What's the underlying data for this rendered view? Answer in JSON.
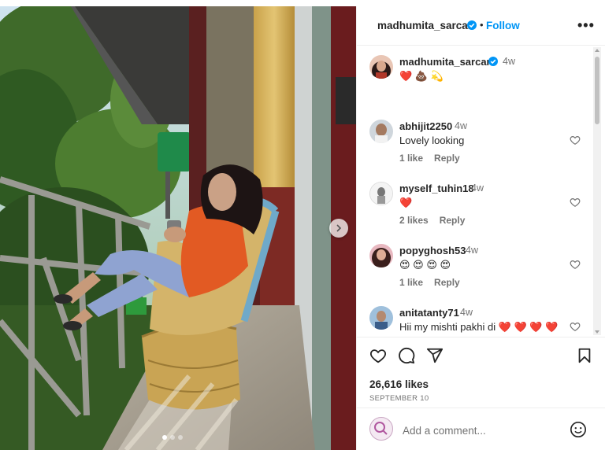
{
  "post": {
    "author": "madhumita_sarcar",
    "follow_label": "Follow",
    "separator": "•",
    "more_label": "•••"
  },
  "caption": {
    "username": "madhumita_sarcar",
    "time": "4w",
    "text": "❤️ 💩 💫"
  },
  "comments": [
    {
      "username": "abhijit2250",
      "time": "4w",
      "text": "Lovely looking",
      "likes": "1 like",
      "reply": "Reply"
    },
    {
      "username": "myself_tuhin18",
      "time": "4w",
      "text": "❤️",
      "likes": "2 likes",
      "reply": "Reply"
    },
    {
      "username": "popyghosh53",
      "time": "4w",
      "text": "😍 😍 😍 😍",
      "likes": "1 like",
      "reply": "Reply"
    },
    {
      "username": "anitatanty71",
      "time": "4w",
      "text": "Hii my mishti pakhi di ❤️ ❤️ ❤️ ❤️",
      "likes": "",
      "reply": ""
    }
  ],
  "stats": {
    "likes": "26,616 likes",
    "date": "SEPTEMBER 10"
  },
  "composer": {
    "placeholder": "Add a comment..."
  },
  "carousel": {
    "slides": 3,
    "active": 1
  },
  "icons": {
    "like": "heart-icon",
    "comment": "comment-icon",
    "share": "share-icon",
    "save": "bookmark-icon",
    "emoji": "emoji-icon",
    "verified": "verified-badge-icon",
    "next": "chevron-right-icon"
  },
  "colors": {
    "accent": "#0095f6",
    "verified": "#0095f6",
    "muted": "#737373",
    "text": "#262626"
  }
}
